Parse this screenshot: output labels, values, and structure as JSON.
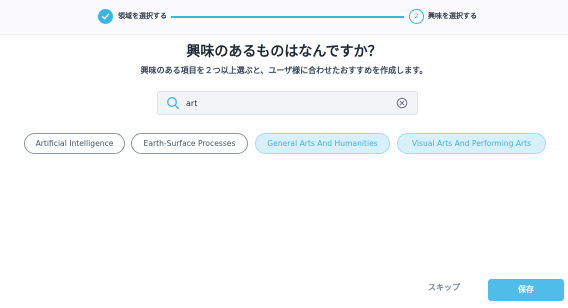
{
  "stepper": {
    "step1_label": "領域を選択する",
    "step2_number": "2",
    "step2_label": "興味を選択する"
  },
  "heading": {
    "title": "興味のあるものはなんですか？",
    "subtitle": "興味のある項目を２つ以上選ぶと、ユーザ様に合わせたおすすめを作成します。"
  },
  "search": {
    "value": "art"
  },
  "chips": [
    {
      "label": "Artificial Intelligence",
      "selected": false
    },
    {
      "label": "Earth-Surface Processes",
      "selected": false
    },
    {
      "label": "General Arts And Humanities",
      "selected": true
    },
    {
      "label": "Visual Arts And Performing Arts",
      "selected": true
    }
  ],
  "footer": {
    "skip_label": "スキップ",
    "save_label": "保存"
  },
  "colors": {
    "accent": "#38b6e8",
    "selected_chip_bg": "#d8f0fa",
    "save_button": "#4fbdea"
  }
}
